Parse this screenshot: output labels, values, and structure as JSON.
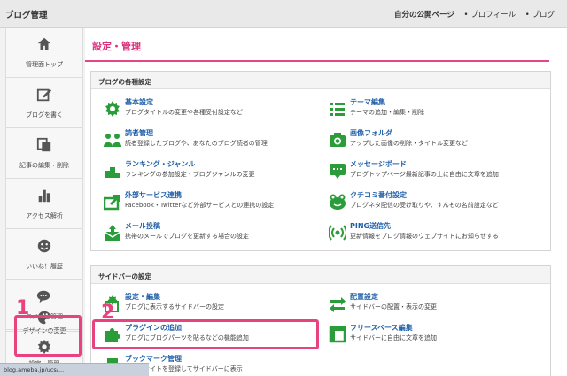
{
  "header": {
    "title": "ブログ管理",
    "links": [
      "自分の公開ページ",
      "• プロフィール",
      "• ブログ"
    ]
  },
  "sidebar": {
    "items": [
      {
        "label": "管理面トップ",
        "icon": "house-icon"
      },
      {
        "label": "ブログを書く",
        "icon": "pencil-icon"
      },
      {
        "label": "記事の編集・削除",
        "icon": "copy-icon"
      },
      {
        "label": "アクセス解析",
        "icon": "bar-chart-icon"
      },
      {
        "label": "いいね！履歴",
        "icon": "smile-icon"
      },
      {
        "label": "コメント管理",
        "icon": "chat-icon"
      },
      {
        "label": "デザインの変更",
        "icon": "palette-icon"
      },
      {
        "label": "設定・管理",
        "icon": "gear-icon"
      }
    ]
  },
  "page": {
    "title": "設定・管理"
  },
  "blog_settings": {
    "heading": "ブログの各種設定",
    "items": [
      {
        "title": "基本設定",
        "desc": "ブログタイトルの変更や各種受付設定など",
        "icon": "gear-icon"
      },
      {
        "title": "テーマ編集",
        "desc": "テーマの追加・編集・削除",
        "icon": "list-icon"
      },
      {
        "title": "読者管理",
        "desc": "読者登録したブログや、あなたのブログ読者の管理",
        "icon": "people-icon"
      },
      {
        "title": "画像フォルダ",
        "desc": "アップした画像の削除・タイトル変更など",
        "icon": "camera-icon"
      },
      {
        "title": "ランキング・ジャンル",
        "desc": "ランキングの参加設定・ブログジャンルの変更",
        "icon": "podium-icon"
      },
      {
        "title": "メッセージボード",
        "desc": "ブログトップページ最新記事の上に自由に文章を追加",
        "icon": "message-board-icon"
      },
      {
        "title": "外部サービス連携",
        "desc": "Facebook・Twitterなど外部サービスとの連携の設定",
        "icon": "share-icon"
      },
      {
        "title": "クチコミ番付設定",
        "desc": "ブログネタ配信の受け取りや、すんもの名前設定など",
        "icon": "frog-icon"
      },
      {
        "title": "メール投稿",
        "desc": "携帯のメールでブログを更新する場合の設定",
        "icon": "mail-icon"
      },
      {
        "title": "PING送信先",
        "desc": "更新情報をブログ情報のウェブサイトにお知らせする",
        "icon": "broadcast-icon"
      }
    ]
  },
  "sidebar_settings": {
    "heading": "サイドバーの設定",
    "items": [
      {
        "title": "設定・編集",
        "desc": "ブログに表示するサイドバーの設定",
        "icon": "settings-edit-icon"
      },
      {
        "title": "配置設定",
        "desc": "サイドバーの配置・表示の変更",
        "icon": "arrows-icon"
      },
      {
        "title": "プラグインの追加",
        "desc": "ブログにブログパーツを貼るなどの機能追加",
        "icon": "puzzle-icon"
      },
      {
        "title": "フリースペース編集",
        "desc": "サイドバーに自由に文章を追加",
        "icon": "window-icon"
      },
      {
        "title": "ブックマーク管理",
        "desc": "入りのサイトを登録してサイドバーに表示",
        "icon": "bookmark-icon"
      }
    ]
  },
  "annotations": {
    "one": "1",
    "two": "2"
  },
  "status": {
    "text": "blog.ameba.jp/ucs/..."
  },
  "colors": {
    "accent": "#e5468a",
    "link": "#1f5fa8",
    "icon": "#2a9d3a",
    "highlight": "#e8437f"
  }
}
